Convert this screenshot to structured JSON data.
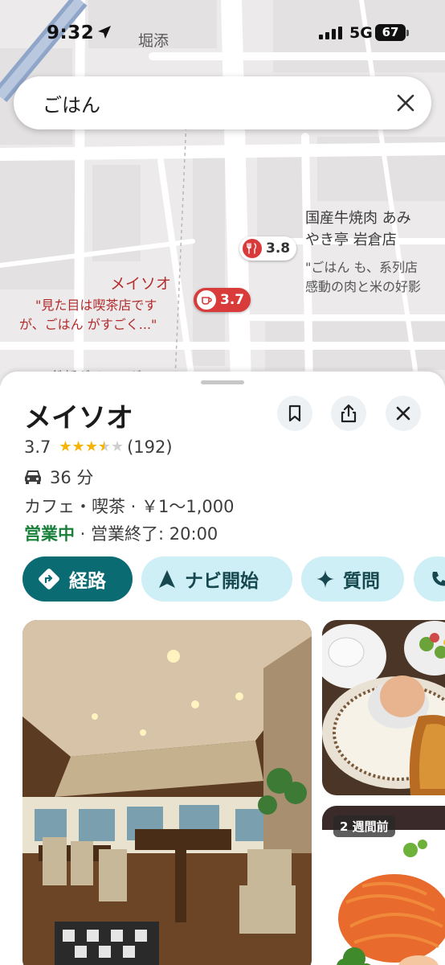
{
  "status_bar": {
    "time": "9:32",
    "network": "5G",
    "battery": "67"
  },
  "map": {
    "area_label": "堀添",
    "place1": {
      "name_line1": "国産牛焼肉 あみ",
      "name_line2": "やき亭 岩倉店",
      "snippet_line1": "\"ごはん も、系列店",
      "snippet_line2": "感動の肉と米の好影",
      "rating": "3.8",
      "icon": "restaurant-icon"
    },
    "place2": {
      "name": "メイソオ",
      "snippet_line1": "\"見た目は喫茶店です",
      "snippet_line2": "が、ごはん がすごく...\"",
      "rating": "3.7",
      "icon": "coffee-icon"
    },
    "bottom_road": "鉄板ダイニング ICHIBAN"
  },
  "search": {
    "query": "ごはん"
  },
  "place": {
    "name": "メイソオ",
    "rating": "3.7",
    "stars": 3.5,
    "review_count": "(192)",
    "drive_time": "36 分",
    "category_line": "カフェ・喫茶 · ￥1～1,000",
    "open_status": "営業中",
    "hours": " · 営業終了: 20:00"
  },
  "actions": {
    "route": "経路",
    "navigate": "ナビ開始",
    "ask": "質問"
  },
  "photos": {
    "badge": "2 週間前"
  },
  "colors": {
    "accent": "#0b6b73",
    "chip_bg": "#cdeff5",
    "open": "#188038",
    "pin": "#d93a3a",
    "star": "#f5b400"
  }
}
